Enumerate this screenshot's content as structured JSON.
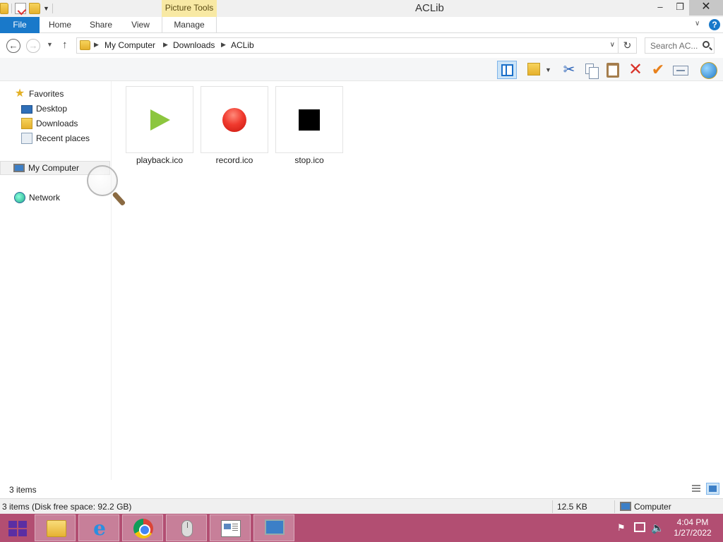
{
  "window": {
    "title": "ACLib",
    "contextual_tab_group": "Picture Tools",
    "controls": {
      "minimize": "–",
      "restore": "❐",
      "close": "✕"
    }
  },
  "ribbon": {
    "tabs": {
      "file": "File",
      "home": "Home",
      "share": "Share",
      "view": "View",
      "manage": "Manage"
    },
    "help": "?"
  },
  "address": {
    "breadcrumb": [
      "My Computer",
      "Downloads",
      "ACLib"
    ],
    "search_placeholder": "Search AC..."
  },
  "toolbar_icons": [
    "layout-pane-icon",
    "select-folder-icon",
    "cut-icon",
    "copy-icon",
    "paste-icon",
    "delete-icon",
    "checkmark-icon",
    "rename-icon",
    "globe-icon"
  ],
  "navpane": {
    "favorites": "Favorites",
    "desktop": "Desktop",
    "downloads": "Downloads",
    "recent": "Recent places",
    "my_computer": "My Computer",
    "network": "Network"
  },
  "files": [
    {
      "name": "playback.ico",
      "icon": "play-icon",
      "color": "#8cc63e"
    },
    {
      "name": "record.ico",
      "icon": "record-icon",
      "color": "#f03a2e"
    },
    {
      "name": "stop.ico",
      "icon": "stop-icon",
      "color": "#000000"
    }
  ],
  "status": {
    "item_count": "3 items",
    "details": "3 items (Disk free space: 92.2 GB)",
    "size": "12.5 KB",
    "location": "Computer"
  },
  "taskbar": {
    "clock_time": "4:04 PM",
    "clock_date": "1/27/2022",
    "accent": "#b24e72"
  }
}
